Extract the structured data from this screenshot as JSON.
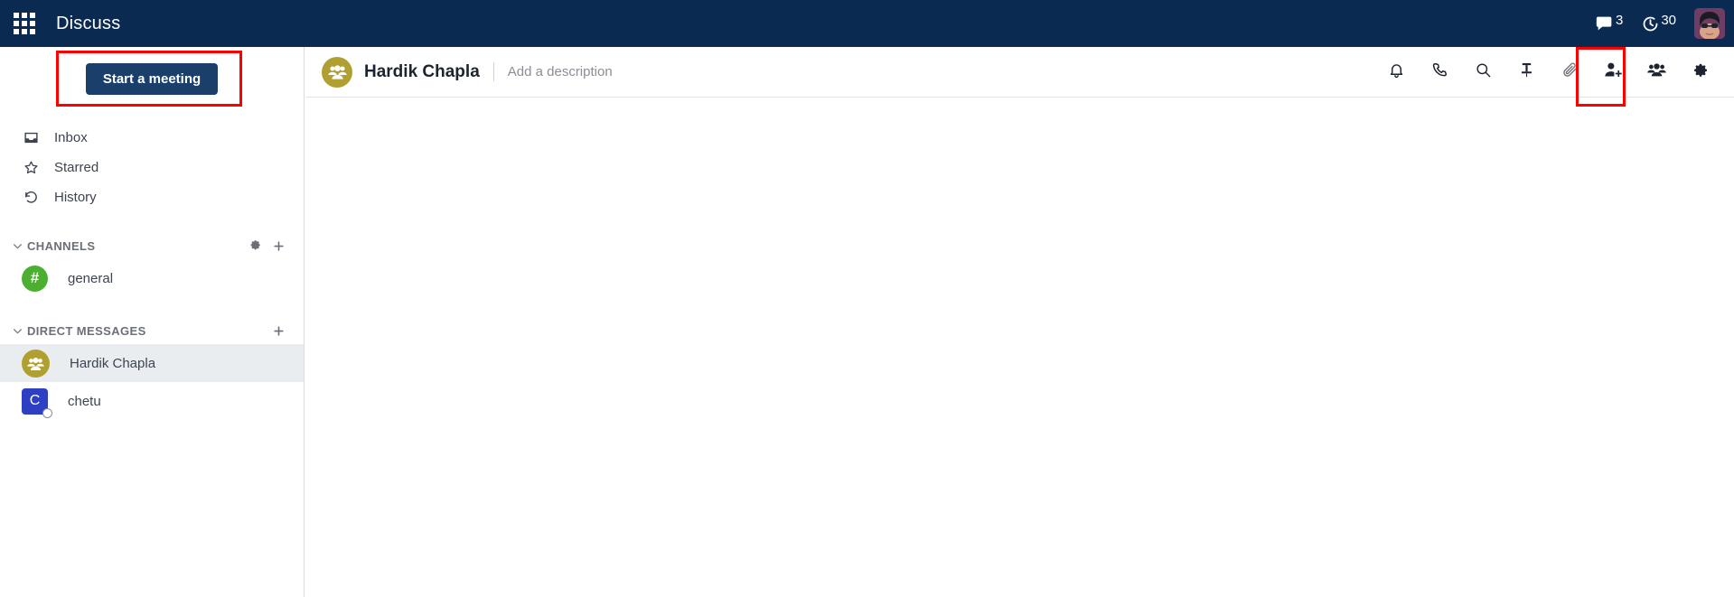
{
  "navbar": {
    "apps_icon": "apps-grid-icon",
    "title": "Discuss",
    "messages": {
      "icon": "chat-bubble-icon",
      "count": "3"
    },
    "activities": {
      "icon": "clock-icon",
      "count": "30"
    },
    "avatar": {
      "icon": "user-avatar",
      "alt": "User avatar"
    }
  },
  "sidebar": {
    "start_meeting_label": "Start a meeting",
    "nav_items": [
      {
        "icon": "inbox-icon",
        "label": "Inbox"
      },
      {
        "icon": "star-icon",
        "label": "Starred"
      },
      {
        "icon": "history-icon",
        "label": "History"
      }
    ],
    "channels_section": {
      "label": "CHANNELS",
      "caret": "chevron-down-icon",
      "gear": "gear-icon",
      "plus": "plus-icon",
      "items": [
        {
          "avatar_type": "hash",
          "avatar_text": "#",
          "label": "general",
          "color": "#4caf32"
        }
      ]
    },
    "dm_section": {
      "label": "DIRECT MESSAGES",
      "caret": "chevron-down-icon",
      "plus": "plus-icon",
      "items": [
        {
          "avatar_type": "group",
          "avatar_text": "",
          "label": "Hardik Chapla",
          "color": "#b0a031",
          "active": true
        },
        {
          "avatar_type": "letter",
          "avatar_text": "C",
          "label": "chetu",
          "color": "#2f3fc4",
          "active": false,
          "status": "offline"
        }
      ]
    }
  },
  "thread": {
    "avatar": "group-avatar-icon",
    "title": "Hardik Chapla",
    "description_placeholder": "Add a description",
    "actions": [
      {
        "icon": "bell-icon",
        "name": "notification-settings-button"
      },
      {
        "icon": "phone-icon",
        "name": "start-call-button"
      },
      {
        "icon": "search-icon",
        "name": "search-messages-button"
      },
      {
        "icon": "pin-icon",
        "name": "pinned-messages-button"
      },
      {
        "icon": "paperclip-icon",
        "name": "attachments-button"
      },
      {
        "icon": "add-person-icon",
        "name": "add-users-button"
      },
      {
        "icon": "group-icon",
        "name": "show-members-button"
      },
      {
        "icon": "gear-icon",
        "name": "thread-settings-button"
      }
    ]
  },
  "highlights": [
    {
      "name": "start-meeting-highlight",
      "color": "#ff0000"
    },
    {
      "name": "add-users-highlight",
      "color": "#ff0000"
    }
  ]
}
